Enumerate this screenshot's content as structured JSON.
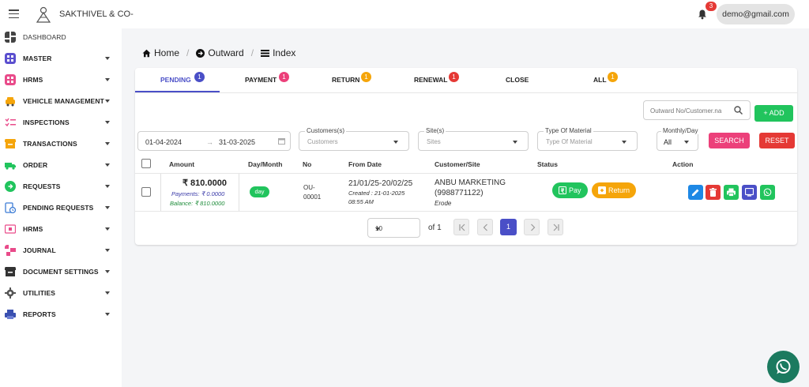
{
  "header": {
    "brand": "SAKTHIVEL & CO-",
    "notification_count": "3",
    "user_email": "demo@gmail.com"
  },
  "sidebar": {
    "items": [
      {
        "label": "DASHBOARD",
        "icon": "dashboard-icon",
        "color": "#444444",
        "expandable": false
      },
      {
        "label": "MASTER",
        "icon": "master-icon",
        "color": "#5b4fcf",
        "expandable": true
      },
      {
        "label": "HRMS",
        "icon": "hrms-icon",
        "color": "#e94b8a",
        "expandable": true
      },
      {
        "label": "VEHICLE MANAGEMENT",
        "icon": "vehicle-icon",
        "color": "#f5a50a",
        "expandable": true
      },
      {
        "label": "INSPECTIONS",
        "icon": "inspections-icon",
        "color": "#e94b8a",
        "expandable": true
      },
      {
        "label": "TRANSACTIONS",
        "icon": "transactions-icon",
        "color": "#f5a50a",
        "expandable": true
      },
      {
        "label": "ORDER",
        "icon": "order-icon",
        "color": "#21c45d",
        "expandable": true
      },
      {
        "label": "REQUESTS",
        "icon": "requests-icon",
        "color": "#21c45d",
        "expandable": true
      },
      {
        "label": "PENDING REQUESTS",
        "icon": "pending-requests-icon",
        "color": "#3a7bd5",
        "expandable": true
      },
      {
        "label": "HRMS",
        "icon": "hrms-card-icon",
        "color": "#e94b8a",
        "expandable": true
      },
      {
        "label": "JOURNAL",
        "icon": "journal-icon",
        "color": "#e94b8a",
        "expandable": true
      },
      {
        "label": "DOCUMENT SETTINGS",
        "icon": "document-settings-icon",
        "color": "#333333",
        "expandable": true
      },
      {
        "label": "UTILITIES",
        "icon": "utilities-icon",
        "color": "#555555",
        "expandable": true
      },
      {
        "label": "REPORTS",
        "icon": "reports-icon",
        "color": "#3a50b0",
        "expandable": true
      }
    ]
  },
  "breadcrumb": {
    "home": "Home",
    "outward": "Outward",
    "index": "Index"
  },
  "tabs": [
    {
      "label": "PENDING",
      "badge": "1",
      "badge_color": "#4a4fc7",
      "active": true
    },
    {
      "label": "PAYMENT",
      "badge": "1",
      "badge_color": "#ec407a",
      "active": false
    },
    {
      "label": "RETURN",
      "badge": "1",
      "badge_color": "#f5a50a",
      "active": false
    },
    {
      "label": "RENEWAL",
      "badge": "1",
      "badge_color": "#e53935",
      "active": false
    },
    {
      "label": "CLOSE",
      "badge": "",
      "badge_color": "",
      "active": false
    },
    {
      "label": "ALL",
      "badge": "1",
      "badge_color": "#f5a50a",
      "active": false
    }
  ],
  "toolbar": {
    "search_placeholder": "Outward No/Customer.na",
    "add_label": "ADD"
  },
  "filters": {
    "date_from": "01-04-2024",
    "date_arrow": "→",
    "date_to": "31-03-2025",
    "customers_label": "Customers(s)",
    "customers_placeholder": "Customers",
    "sites_label": "Site(s)",
    "sites_placeholder": "Sites",
    "material_label": "Type Of Material",
    "material_placeholder": "Type Of Material",
    "monthly_label": "Monthly/Day",
    "monthly_value": "All",
    "search_label": "SEARCH",
    "reset_label": "RESET"
  },
  "table": {
    "headers": {
      "amount": "Amount",
      "day_month": "Day/Month",
      "no": "No",
      "from_date": "From Date",
      "customer_site": "Customer/Site",
      "status": "Status",
      "action": "Action"
    },
    "rows": [
      {
        "amount": "₹ 810.0000",
        "payments": "Payments: ₹ 0.0000",
        "balance": "Balance: ₹ 810.0000",
        "day_month": "day",
        "no_line1": "OU-",
        "no_line2": "00001",
        "date_range": "21/01/25-20/02/25",
        "created": "Created : 21-01-2025",
        "created_time": "08:55 AM",
        "customer": "ANBU MARKETING",
        "phone": "(9988771122)",
        "site": "Erode",
        "pay_label": "Pay",
        "return_label": "Return"
      }
    ]
  },
  "pagination": {
    "page_size": "10",
    "of_label": "of 1",
    "current_page": "1"
  },
  "colors": {
    "primary": "#4a4fc7",
    "success": "#21c45d",
    "pink": "#ec407a",
    "danger": "#e53935",
    "warning": "#f5a50a",
    "info": "#1e88e5",
    "whatsapp": "#1b7a5f"
  }
}
